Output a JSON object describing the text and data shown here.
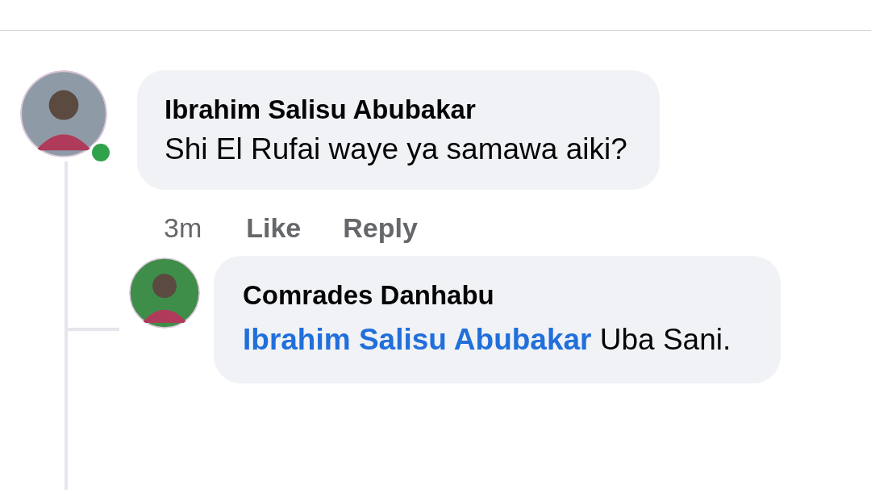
{
  "comment": {
    "author": "Ibrahim Salisu Abubakar",
    "online": true,
    "text": "Shi El Rufai waye ya samawa aiki?",
    "time": "3m",
    "actions": [
      "Like",
      "Reply"
    ]
  },
  "reply": {
    "author": "Comrades Danhabu",
    "mention": "Ibrahim Salisu Abubakar",
    "text": "Uba Sani."
  }
}
